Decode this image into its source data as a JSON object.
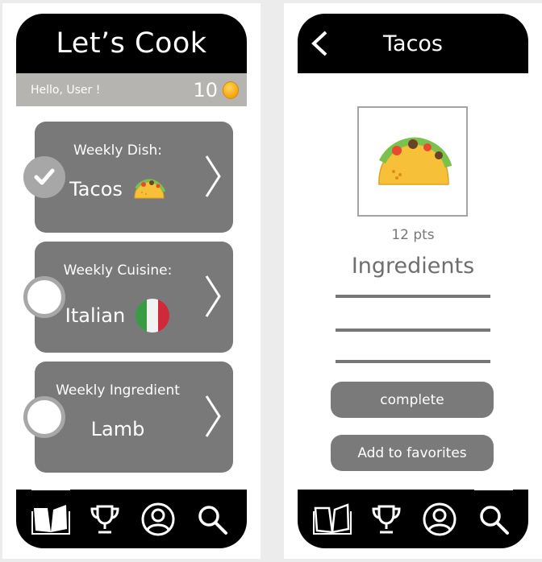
{
  "left_screen": {
    "app_title": "Let’s Cook",
    "greeting": "Hello, User !",
    "coins": "10",
    "cards": [
      {
        "label": "Weekly Dish:",
        "value": "Tacos",
        "status": "checked"
      },
      {
        "label": "Weekly Cuisine:",
        "value": "Italian",
        "status": "unchecked"
      },
      {
        "label": "Weekly Ingredient",
        "value": "Lamb",
        "status": "unchecked"
      }
    ],
    "nav": [
      "book-icon",
      "trophy-icon",
      "profile-icon",
      "search-icon"
    ],
    "nav_active": "book-icon"
  },
  "right_screen": {
    "title": "Tacos",
    "points": "12 pts",
    "ingredients_heading": "Ingredients",
    "buttons": {
      "complete": "complete",
      "favorites": "Add to favorites"
    },
    "nav": [
      "book-icon",
      "trophy-icon",
      "profile-icon",
      "search-icon"
    ],
    "nav_active": "search-icon"
  },
  "colors": {
    "header": "#000000",
    "card": "#797979",
    "greet_bar": "#b6b4b1",
    "coin": "#f3a510",
    "button": "#7a7a7a"
  }
}
